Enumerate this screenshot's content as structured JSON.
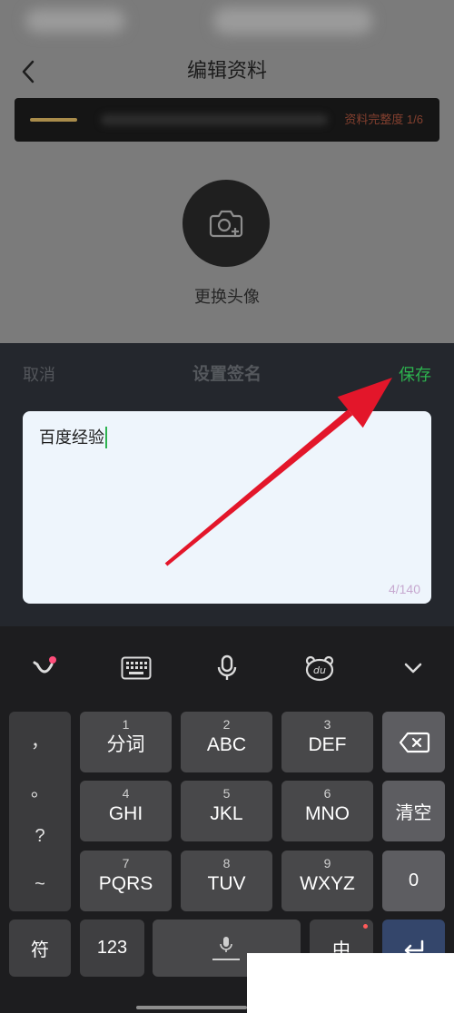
{
  "colors": {
    "page_dim": "#7b7b7b",
    "accent_green": "#2db34f",
    "annotation_red": "#e3162a",
    "counter_text": "#c7a9d0",
    "progress_gold": "#a98c4b",
    "completeness_text": "#84402f",
    "enter_key": "#34466b"
  },
  "header": {
    "back_icon": "chevron-left-icon",
    "title": "编辑资料"
  },
  "profile": {
    "completeness_label": "资料完整度 1/6",
    "avatar_icon": "camera-plus-icon",
    "change_avatar_label": "更换头像"
  },
  "signature_sheet": {
    "cancel_label": "取消",
    "title": "设置签名",
    "save_label": "保存",
    "input_value": "百度经验",
    "char_counter": "4/140"
  },
  "keyboard": {
    "toolbar_icons": [
      "emoji-smile-icon",
      "keyboard-icon",
      "microphone-icon",
      "baidu-bear-icon",
      "chevron-down-icon"
    ],
    "bear_logo_text": "du",
    "symbols": [
      "，",
      "。",
      "?",
      "~"
    ],
    "rows": [
      [
        {
          "num": "1",
          "label": "分词"
        },
        {
          "num": "2",
          "label": "ABC"
        },
        {
          "num": "3",
          "label": "DEF"
        }
      ],
      [
        {
          "num": "4",
          "label": "GHI"
        },
        {
          "num": "5",
          "label": "JKL"
        },
        {
          "num": "6",
          "label": "MNO"
        }
      ],
      [
        {
          "num": "7",
          "label": "PQRS"
        },
        {
          "num": "8",
          "label": "TUV"
        },
        {
          "num": "9",
          "label": "WXYZ"
        }
      ]
    ],
    "delete_icon": "backspace-icon",
    "clear_label": "清空",
    "zero_label": "0",
    "symbols_key_label": "符",
    "numbers_key_label": "123",
    "space_icon": "microphone-icon",
    "lang_key_label": "中",
    "enter_icon": "return-icon"
  }
}
